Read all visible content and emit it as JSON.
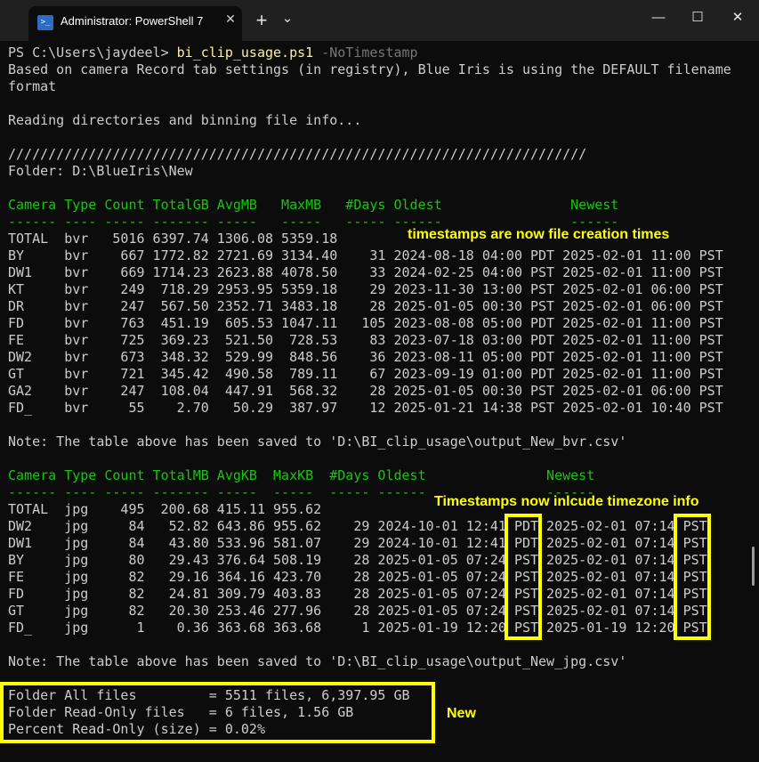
{
  "window": {
    "tab_title": "Administrator: PowerShell 7",
    "tab_icon": "powershell-icon",
    "close_tab": "✕",
    "new_tab": "+",
    "dropdown": "⌄",
    "minimize": "—",
    "maximize": "☐",
    "close": "✕"
  },
  "terminal": {
    "prompt": "PS C:\\Users\\jaydeel> ",
    "command": "bi_clip_usage.ps1",
    "arg": " -NoTimestamp",
    "info1": "Based on camera Record tab settings (in registry), Blue Iris is using the DEFAULT filename",
    "info2": "format",
    "reading": "Reading directories and binning file info...",
    "slashes": "////////////////////////////////////////////////////////////////////////",
    "folder": "Folder: D:\\BlueIris\\New",
    "bvr_header": "Camera Type Count TotalGB AvgMB   MaxMB   #Days Oldest                Newest",
    "bvr_dashes": "------ ---- ----- ------- -----   -----   ----- ------                ------",
    "bvr_rows": [
      "TOTAL  bvr   5016 6397.74 1306.08 5359.18",
      "BY     bvr    667 1772.82 2721.69 3134.40    31 2024-08-18 04:00 PDT 2025-02-01 11:00 PST",
      "DW1    bvr    669 1714.23 2623.88 4078.50    33 2024-02-25 04:00 PST 2025-02-01 11:00 PST",
      "KT     bvr    249  718.29 2953.95 5359.18    29 2023-11-30 13:00 PST 2025-02-01 06:00 PST",
      "DR     bvr    247  567.50 2352.71 3483.18    28 2025-01-05 00:30 PST 2025-02-01 06:00 PST",
      "FD     bvr    763  451.19  605.53 1047.11   105 2023-08-08 05:00 PDT 2025-02-01 11:00 PST",
      "FE     bvr    725  369.23  521.50  728.53    83 2023-07-18 03:00 PDT 2025-02-01 11:00 PST",
      "DW2    bvr    673  348.32  529.99  848.56    36 2023-08-11 05:00 PDT 2025-02-01 11:00 PST",
      "GT     bvr    721  345.42  490.58  789.11    67 2023-09-19 01:00 PDT 2025-02-01 11:00 PST",
      "GA2    bvr    247  108.04  447.91  568.32    28 2025-01-05 00:30 PST 2025-02-01 06:00 PST",
      "FD_    bvr     55    2.70   50.29  387.97    12 2025-01-21 14:38 PST 2025-02-01 10:40 PST"
    ],
    "bvr_note": "Note: The table above has been saved to 'D:\\BI_clip_usage\\output_New_bvr.csv'",
    "jpg_header": "Camera Type Count TotalMB AvgKB  MaxKB  #Days Oldest               Newest",
    "jpg_dashes": "------ ---- ----- ------- -----  -----  ----- ------               ------",
    "jpg_rows": [
      "TOTAL  jpg    495  200.68 415.11 955.62",
      "DW2    jpg     84   52.82 643.86 955.62    29 2024-10-01 12:41 PDT 2025-02-01 07:14 PST",
      "DW1    jpg     84   43.80 533.96 581.07    29 2024-10-01 12:41 PDT 2025-02-01 07:14 PST",
      "BY     jpg     80   29.43 376.64 508.19    28 2025-01-05 07:24 PST 2025-02-01 07:14 PST",
      "FE     jpg     82   29.16 364.16 423.70    28 2025-01-05 07:24 PST 2025-02-01 07:14 PST",
      "FD     jpg     82   24.81 309.79 403.83    28 2025-01-05 07:24 PST 2025-02-01 07:14 PST",
      "GT     jpg     82   20.30 253.46 277.96    28 2025-01-05 07:24 PST 2025-02-01 07:14 PST",
      "FD_    jpg      1    0.36 363.68 363.68     1 2025-01-19 12:20 PST 2025-01-19 12:20 PST"
    ],
    "jpg_note": "Note: The table above has been saved to 'D:\\BI_clip_usage\\output_New_jpg.csv'",
    "summary": [
      "Folder All files         = 5511 files, 6,397.95 GB",
      "Folder Read-Only files   = 6 files, 1.56 GB",
      "Percent Read-Only (size) = 0.02%"
    ]
  },
  "annotations": {
    "creation_times": "timestamps are now file creation times",
    "timezone": "Timestamps now inlcude timezone info",
    "new": "New",
    "highlight_color": "#ffff00"
  }
}
